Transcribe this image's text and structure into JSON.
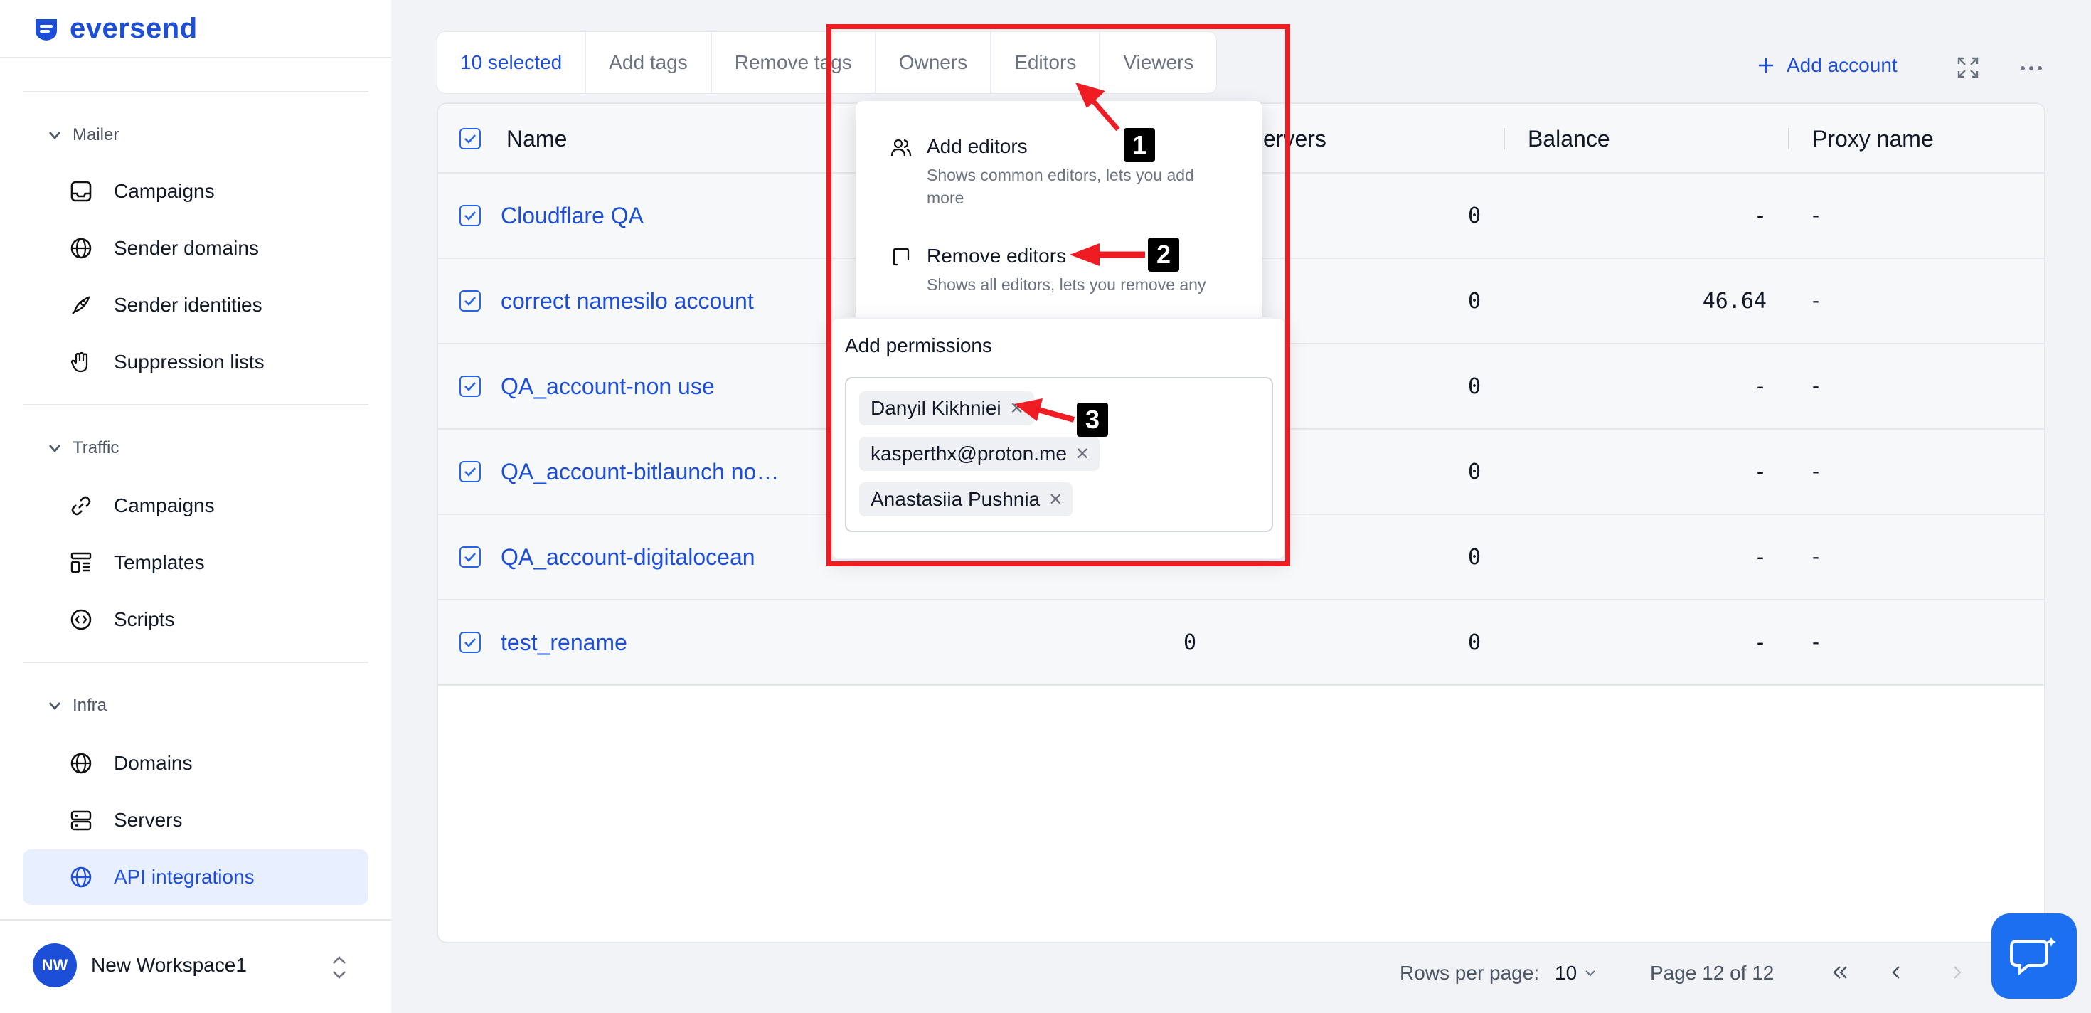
{
  "brand": {
    "name": "eversend"
  },
  "sidebar": {
    "sections": [
      {
        "title": "Mailer",
        "items": [
          "Campaigns",
          "Sender domains",
          "Sender identities",
          "Suppression lists"
        ]
      },
      {
        "title": "Traffic",
        "items": [
          "Campaigns",
          "Templates",
          "Scripts"
        ]
      },
      {
        "title": "Infra",
        "items": [
          "Domains",
          "Servers",
          "API integrations"
        ]
      }
    ],
    "active_item": "API integrations",
    "workspace": {
      "initials": "NW",
      "name": "New Workspace1"
    }
  },
  "toolbar": {
    "selected": "10 selected",
    "actions": [
      "Add tags",
      "Remove tags",
      "Owners",
      "Editors",
      "Viewers"
    ],
    "add_account": "Add account"
  },
  "table": {
    "columns": {
      "name": "Name",
      "servers": "ervers",
      "balance": "Balance",
      "proxy": "Proxy name"
    },
    "rows": [
      {
        "name": "Cloudflare QA",
        "col_a": "",
        "servers": "0",
        "balance": "-",
        "proxy": "-"
      },
      {
        "name": "correct namesilo account",
        "col_a": "",
        "servers": "0",
        "balance": "46.64",
        "proxy": "-"
      },
      {
        "name": "QA_account-non use",
        "col_a": "",
        "servers": "0",
        "balance": "-",
        "proxy": "-"
      },
      {
        "name": "QA_account-bitlaunch no…",
        "col_a": "",
        "servers": "0",
        "balance": "-",
        "proxy": "-"
      },
      {
        "name": "QA_account-digitalocean",
        "col_a": "",
        "servers": "0",
        "balance": "-",
        "proxy": "-"
      },
      {
        "name": "test_rename",
        "col_a": "0",
        "servers": "0",
        "balance": "-",
        "proxy": "-"
      }
    ]
  },
  "pagination": {
    "rows_label": "Rows per page:",
    "rows_value": "10",
    "page_label": "Page 12 of 12"
  },
  "editors_menu": {
    "add": {
      "title": "Add editors",
      "desc": "Shows common editors, lets you add more"
    },
    "remove": {
      "title": "Remove editors",
      "desc": "Shows all editors, lets you remove any"
    }
  },
  "permissions": {
    "title": "Add permissions",
    "chips": [
      "Danyil Kikhniei",
      "kasperthx@proton.me",
      "Anastasiia Pushnia"
    ]
  },
  "annotations": {
    "badges": [
      "1",
      "2",
      "3"
    ],
    "color": "#ef1c24"
  },
  "colors": {
    "accent": "#1d4ed8",
    "fab": "#1d6ff2"
  }
}
